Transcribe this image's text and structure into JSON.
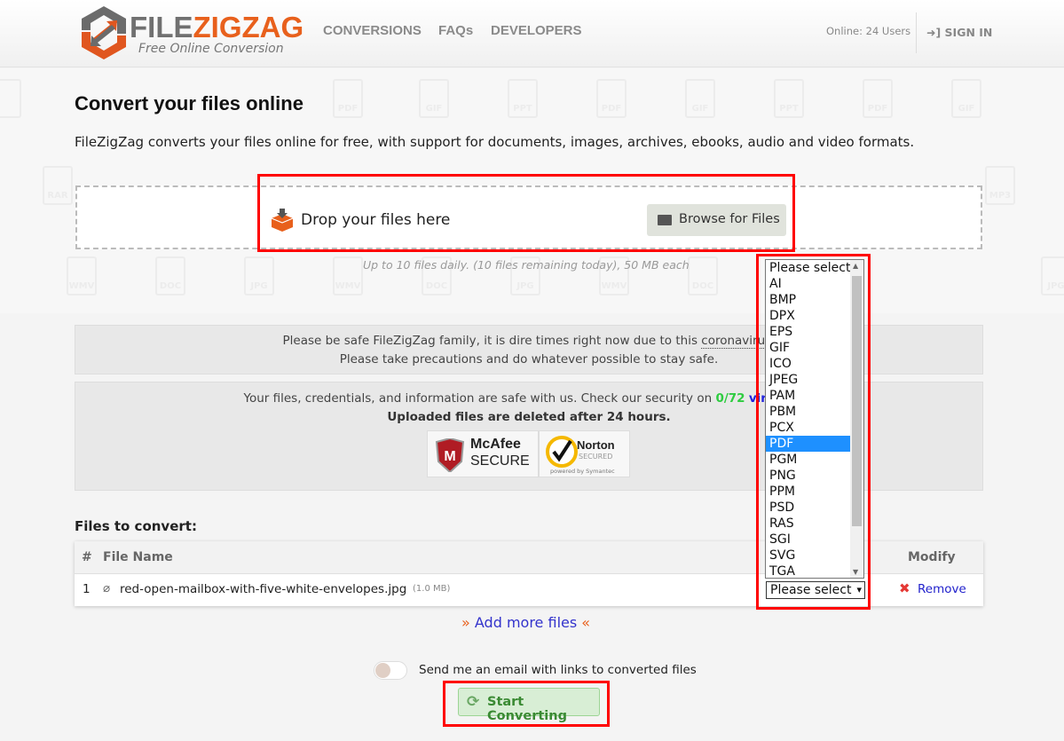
{
  "header": {
    "brand_a": "FILE",
    "brand_b": "ZIGZAG",
    "tagline": "Free Online Conversion",
    "nav": [
      "CONVERSIONS",
      "FAQs",
      "DEVELOPERS"
    ],
    "online": "Online: 24 Users",
    "signin": "SIGN IN"
  },
  "hero": {
    "title": "Convert your files online",
    "intro": "FileZigZag converts your files online for free, with support for documents, images, archives, ebooks, audio and video formats.",
    "drop": "Drop your files here",
    "browse": "Browse for Files",
    "limit": "Up to 10 files daily. (10 files remaining today), 50 MB each"
  },
  "watermarks": [
    "PDF",
    "GIF",
    "PPT",
    "PDF",
    "GIF",
    "PPT",
    "PDF",
    "GIF",
    "RAR",
    "MP3",
    "WMV",
    "DOC",
    "JPG",
    "WMV",
    "DOC",
    "JPG",
    "WMV",
    "DOC",
    "JPG"
  ],
  "notice": {
    "line1": "Please be safe FileZigZag family, it is dire times right now due to this",
    "link": "coronavirus",
    "line1_end": ".",
    "line2": "Please take precautions and do whatever possible to stay safe."
  },
  "security": {
    "text": "Your files, credentials, and information are safe with us. Check our security on",
    "score": "0/72",
    "link": "virustotal",
    "deleted": "Uploaded files are deleted after 24 hours.",
    "mcafee_a": "McAfee",
    "mcafee_b": "SECURE",
    "norton_a": "Norton",
    "norton_b": "SECURED",
    "norton_c": "powered by Symantec"
  },
  "files": {
    "title": "Files to convert:",
    "headers": {
      "num": "#",
      "name": "File Name",
      "modify": "Modify"
    },
    "rows": [
      {
        "num": "1",
        "name": "red-open-mailbox-with-five-white-envelopes.jpg",
        "size": "(1.0 MB)",
        "format": "Please select",
        "remove": "Remove"
      }
    ]
  },
  "dropdown": {
    "options": [
      "Please select",
      "AI",
      "BMP",
      "DPX",
      "EPS",
      "GIF",
      "ICO",
      "JPEG",
      "PAM",
      "PBM",
      "PCX",
      "PDF",
      "PGM",
      "PNG",
      "PPM",
      "PSD",
      "RAS",
      "SGI",
      "SVG",
      "TGA"
    ],
    "highlighted": "PDF"
  },
  "add_more": "Add more files",
  "email_toggle": {
    "label": "Send me an email with links to converted files",
    "on": false
  },
  "start": "Start Converting",
  "colors": {
    "accent": "#e8601c",
    "highlight": "#1e90ff",
    "annotation": "#ff0000"
  }
}
